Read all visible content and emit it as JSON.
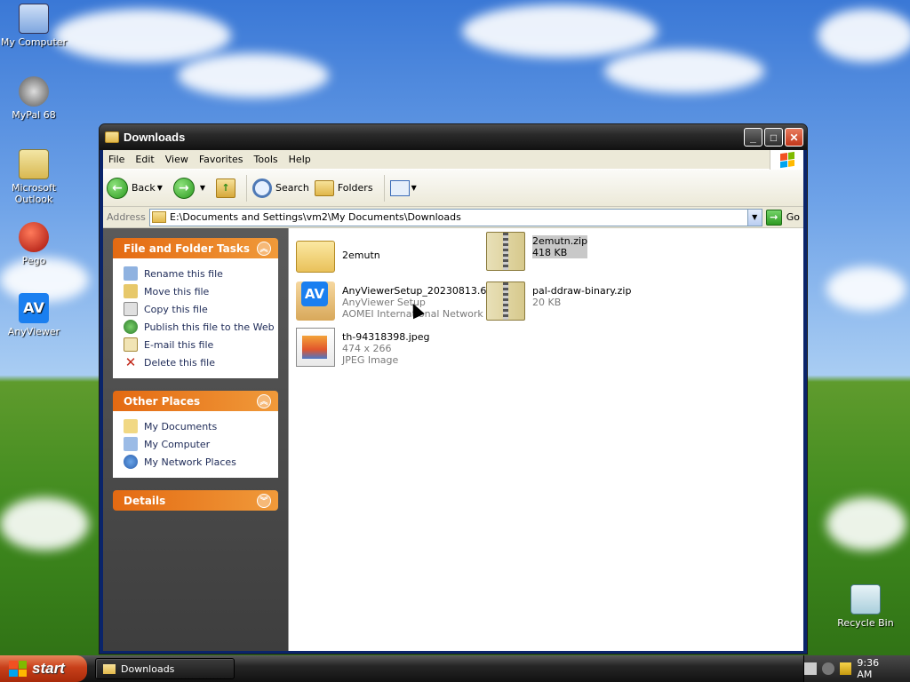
{
  "desktop": {
    "icons": [
      {
        "label": "My Computer"
      },
      {
        "label": "MyPal 68"
      },
      {
        "label": "Microsoft\nOutlook"
      },
      {
        "label": "Pego"
      },
      {
        "label": "AnyViewer"
      },
      {
        "label": "Recycle Bin"
      }
    ]
  },
  "window": {
    "title": "Downloads",
    "menu": [
      "File",
      "Edit",
      "View",
      "Favorites",
      "Tools",
      "Help"
    ],
    "toolbar": {
      "back": "Back",
      "search": "Search",
      "folders": "Folders"
    },
    "address": {
      "label": "Address",
      "path": "E:\\Documents and Settings\\vm2\\My Documents\\Downloads",
      "go": "Go"
    }
  },
  "taskpane": {
    "file_tasks": {
      "title": "File and Folder Tasks",
      "items": [
        "Rename this file",
        "Move this file",
        "Copy this file",
        "Publish this file to the Web",
        "E-mail this file",
        "Delete this file"
      ]
    },
    "other_places": {
      "title": "Other Places",
      "items": [
        "My Documents",
        "My Computer",
        "My Network Places"
      ]
    },
    "details": {
      "title": "Details"
    }
  },
  "files": [
    {
      "name": "2emutn",
      "meta1": "",
      "meta2": "",
      "type": "folder"
    },
    {
      "name": "2emutn.zip",
      "meta1": "418 KB",
      "meta2": "",
      "type": "zip",
      "selected": true
    },
    {
      "name": "AnyViewerSetup_20230813.6...",
      "meta1": "AnyViewer Setup",
      "meta2": "AOMEI International Network ...",
      "type": "exe"
    },
    {
      "name": "pal-ddraw-binary.zip",
      "meta1": "20 KB",
      "meta2": "",
      "type": "zip"
    },
    {
      "name": "th-94318398.jpeg",
      "meta1": "474 x 266",
      "meta2": "JPEG Image",
      "type": "jpeg"
    }
  ],
  "taskbar": {
    "start": "start",
    "active_window": "Downloads",
    "clock": "9:36 AM"
  },
  "colors": {
    "accent_orange": "#e46a12",
    "taskbar_dark": "#262626",
    "start_red": "#c8401a"
  }
}
